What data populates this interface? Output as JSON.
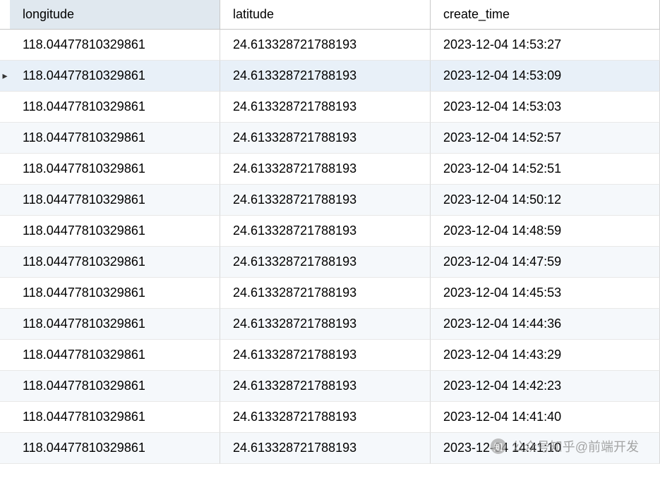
{
  "table": {
    "headers": {
      "longitude": "longitude",
      "latitude": "latitude",
      "create_time": "create_time"
    },
    "selected_row_index": 1,
    "rows": [
      {
        "longitude": "118.04477810329861",
        "latitude": "24.613328721788193",
        "create_time": "2023-12-04 14:53:27"
      },
      {
        "longitude": "118.04477810329861",
        "latitude": "24.613328721788193",
        "create_time": "2023-12-04 14:53:09"
      },
      {
        "longitude": "118.04477810329861",
        "latitude": "24.613328721788193",
        "create_time": "2023-12-04 14:53:03"
      },
      {
        "longitude": "118.04477810329861",
        "latitude": "24.613328721788193",
        "create_time": "2023-12-04 14:52:57"
      },
      {
        "longitude": "118.04477810329861",
        "latitude": "24.613328721788193",
        "create_time": "2023-12-04 14:52:51"
      },
      {
        "longitude": "118.04477810329861",
        "latitude": "24.613328721788193",
        "create_time": "2023-12-04 14:50:12"
      },
      {
        "longitude": "118.04477810329861",
        "latitude": "24.613328721788193",
        "create_time": "2023-12-04 14:48:59"
      },
      {
        "longitude": "118.04477810329861",
        "latitude": "24.613328721788193",
        "create_time": "2023-12-04 14:47:59"
      },
      {
        "longitude": "118.04477810329861",
        "latitude": "24.613328721788193",
        "create_time": "2023-12-04 14:45:53"
      },
      {
        "longitude": "118.04477810329861",
        "latitude": "24.613328721788193",
        "create_time": "2023-12-04 14:44:36"
      },
      {
        "longitude": "118.04477810329861",
        "latitude": "24.613328721788193",
        "create_time": "2023-12-04 14:43:29"
      },
      {
        "longitude": "118.04477810329861",
        "latitude": "24.613328721788193",
        "create_time": "2023-12-04 14:42:23"
      },
      {
        "longitude": "118.04477810329861",
        "latitude": "24.613328721788193",
        "create_time": "2023-12-04 14:41:40"
      },
      {
        "longitude": "118.04477810329861",
        "latitude": "24.613328721788193",
        "create_time": "2023-12-04 14:41:10"
      }
    ]
  },
  "watermark": {
    "text": "公众号知乎@前端开发",
    "icon_label": "知"
  }
}
